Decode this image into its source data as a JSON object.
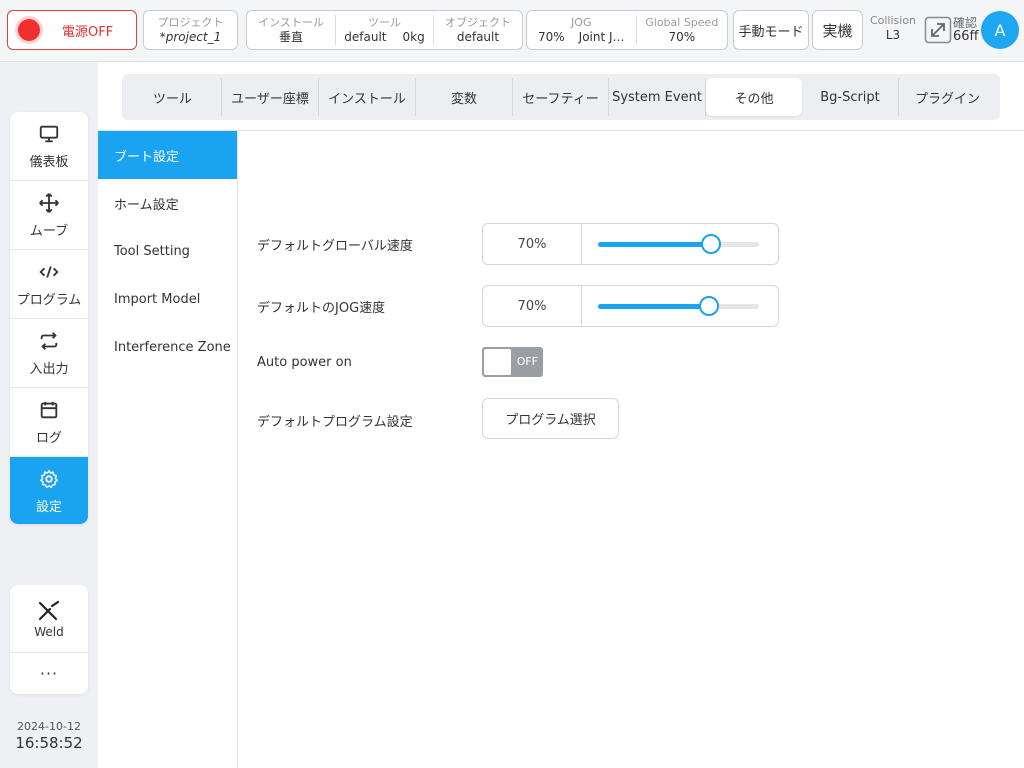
{
  "topbar": {
    "power_label": "電源OFF",
    "project_title": "プロジェクト",
    "project_name": "*project_1",
    "install_title": "インストール",
    "install_value": "垂直",
    "tool_title": "ツール",
    "tool_name": "default",
    "tool_weight": "0kg",
    "object_title": "オブジェクト",
    "object_value": "default",
    "jog_title": "JOG",
    "jog_speed": "70%",
    "jog_mode": "Joint J…",
    "global_speed_title": "Global Speed",
    "global_speed_value": "70%",
    "mode_label": "手動モード",
    "real_label": "実機",
    "collision_title": "Collision",
    "collision_value": "L3",
    "confirm_title": "確認",
    "confirm_value": "66ff",
    "avatar_letter": "A"
  },
  "nav": {
    "items": [
      {
        "label": "儀表板",
        "icon": "monitor-icon"
      },
      {
        "label": "ムーブ",
        "icon": "move-icon"
      },
      {
        "label": "プログラム",
        "icon": "code-icon"
      },
      {
        "label": "入出力",
        "icon": "repeat-icon"
      },
      {
        "label": "ログ",
        "icon": "calendar-icon"
      },
      {
        "label": "設定",
        "icon": "gear-icon"
      }
    ],
    "weld_label": "Weld",
    "more_label": "···"
  },
  "clock": {
    "date": "2024-10-12",
    "time": "16:58:52"
  },
  "tabs": [
    "ツール",
    "ユーザー座標",
    "インストール",
    "変数",
    "セーフティー",
    "System Event",
    "その他",
    "Bg-Script",
    "プラグイン"
  ],
  "subnav": [
    "ブート設定",
    "ホーム設定",
    "Tool Setting",
    "Import Model",
    "Interference Zone"
  ],
  "settings": {
    "global_speed_label": "デフォルトグローバル速度",
    "global_speed_value": "70%",
    "global_speed_level": 0.7,
    "jog_speed_label": "デフォルトのJOG速度",
    "jog_speed_value": "70%",
    "jog_speed_level": 0.69,
    "auto_power_label": "Auto power on",
    "auto_power_state": "OFF",
    "default_program_label": "デフォルトプログラム設定",
    "program_select_label": "プログラム選択"
  },
  "colors": {
    "accent": "#1aa3f0",
    "power_red": "#f03030"
  }
}
